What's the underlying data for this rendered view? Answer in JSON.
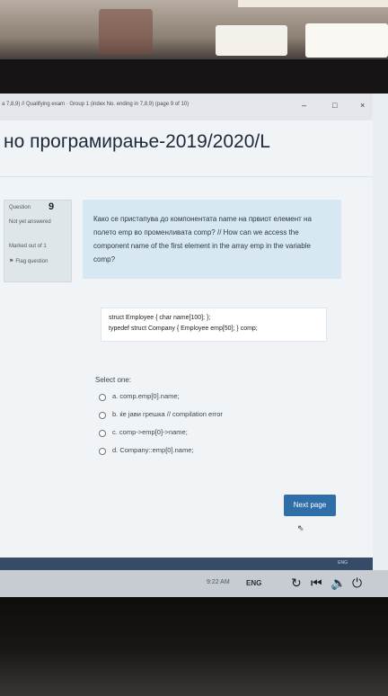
{
  "window": {
    "title": "a 7,8,9) // Qualifying exam · Group 1 (index No. ending in 7,8,9) (page 9 of 10)",
    "min": "–",
    "max": "□",
    "close": "×"
  },
  "page": {
    "heading": "но програмирање-2019/2020/L"
  },
  "question_info": {
    "label": "Question",
    "number": "9",
    "state": "Not yet answered",
    "marked": "Marked out of 1",
    "flag": "Flag question"
  },
  "question": {
    "text": "Како се пристапува до компонентата name на првиот елемент на полето emp во променливата comp? // How can we access the component name of the first element in the array emp in the variable comp?",
    "code_line1": "struct Employee { char name[100]; };",
    "code_line2": "typedef struct Company { Employee emp[50]; } comp;",
    "select_label": "Select one:",
    "options": [
      {
        "label": "a. comp.emp[0].name;"
      },
      {
        "label": "b. ќе јави грешка // compilation error"
      },
      {
        "label": "c. comp->emp[0]->name;"
      },
      {
        "label": "d. Company::emp[0].name;"
      }
    ]
  },
  "buttons": {
    "next": "Next page"
  },
  "footer": {
    "eng_small": "ENG"
  },
  "taskbar": {
    "time": "9:22 AM",
    "lang": "ENG",
    "icons": [
      "refresh-icon",
      "skip-back-icon",
      "volume-icon",
      "power-icon"
    ]
  },
  "colors": {
    "accent": "#2f6ea7",
    "question_bg": "#d7e8f2",
    "footer_bar": "#364b68"
  }
}
